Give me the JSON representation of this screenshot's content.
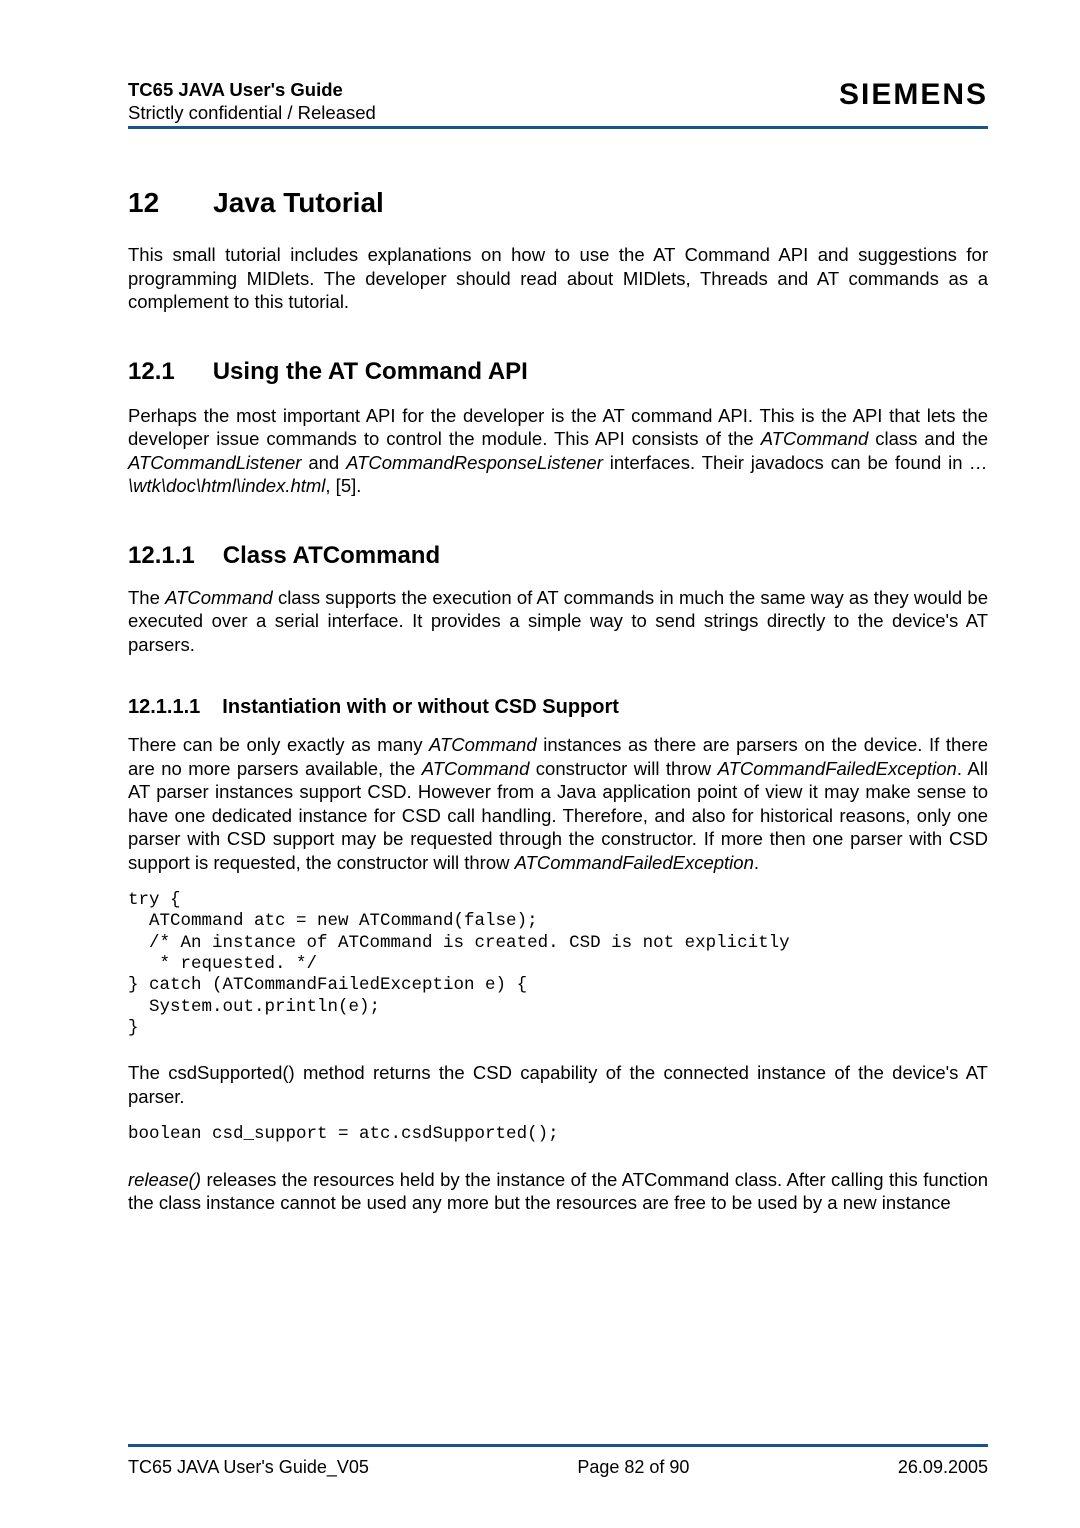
{
  "header": {
    "title": "TC65 JAVA User's Guide",
    "subtitle": "Strictly confidential / Released",
    "brand": "SIEMENS"
  },
  "chapter": {
    "num": "12",
    "title": "Java Tutorial",
    "intro": "This small tutorial includes explanations on how to use the AT Command API and suggestions for programming MIDlets. The developer should read about MIDlets, Threads and AT commands as a complement to this tutorial."
  },
  "sec12_1": {
    "num": "12.1",
    "title": "Using the AT Command API",
    "p_pre": "Perhaps the most important API for the developer is the AT command API. This is the API that lets the developer issue commands to control the module. This API consists of the ",
    "p_it1": "ATCommand",
    "p_mid1": " class and the ",
    "p_it2": "ATCommandListener",
    "p_mid2": " and ",
    "p_it3": "ATCommandResponseListener",
    "p_mid3": " interfaces. Their javadocs can be found in ",
    "p_it4": "…\\wtk\\doc\\html\\index.html",
    "p_post": ", [5]."
  },
  "sec12_1_1": {
    "num": "12.1.1",
    "title": "Class ATCommand",
    "p_pre": "The ",
    "p_it1": "ATCommand",
    "p_post": " class supports the execution of AT commands in much the same way as they would be executed over a serial interface. It provides a simple way to send strings directly to the device's AT parsers."
  },
  "sec12_1_1_1": {
    "num": "12.1.1.1",
    "title": "Instantiation with or without CSD Support",
    "p1_pre": "There can be only exactly as many ",
    "p1_it1": "ATCommand",
    "p1_mid1": " instances as there are parsers on the device. If there are no more parsers available, the ",
    "p1_it2": "ATCommand",
    "p1_mid2": " constructor will throw ",
    "p1_it3": "ATCommandFailedException",
    "p1_mid3": ". All AT parser instances support CSD. However from a Java application point of view it may make sense to have one dedicated instance for CSD call handling. Therefore, and also for historical reasons, only one parser with CSD support may be requested through the constructor. If more then one parser with CSD support is requested, the constructor will throw ",
    "p1_it4": "ATCommandFailedException",
    "p1_post": ".",
    "code1": "try {\n  ATCommand atc = new ATCommand(false);\n  /* An instance of ATCommand is created. CSD is not explicitly\n   * requested. */\n} catch (ATCommandFailedException e) {\n  System.out.println(e);\n}",
    "p2": "The csdSupported() method returns the CSD capability of the connected instance of the device's AT parser.",
    "code2": "boolean csd_support = atc.csdSupported();",
    "p3_it": "release()",
    "p3_post": " releases the resources held by the instance of the ATCommand class. After calling this function the class instance cannot be used any more but the resources are free to be used by a new instance"
  },
  "footer": {
    "left": "TC65 JAVA User's Guide_V05",
    "center": "Page 82 of 90",
    "right": "26.09.2005"
  }
}
